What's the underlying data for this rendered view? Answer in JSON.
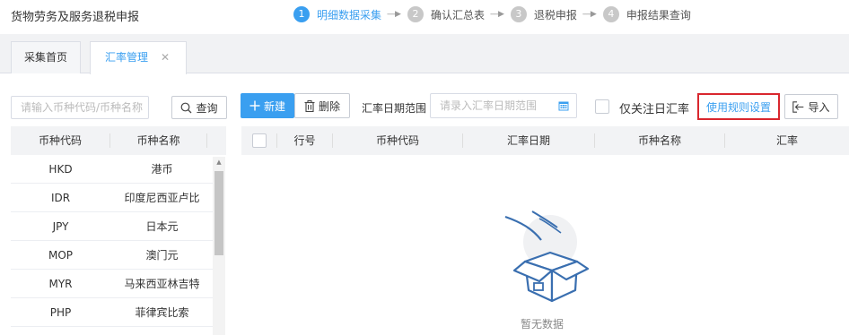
{
  "header": {
    "app_title": "货物劳务及服务退税申报",
    "steps": [
      {
        "num": "1",
        "label": "明细数据采集",
        "active": true
      },
      {
        "num": "2",
        "label": "确认汇总表",
        "active": false
      },
      {
        "num": "3",
        "label": "退税申报",
        "active": false
      },
      {
        "num": "4",
        "label": "申报结果查询",
        "active": false
      }
    ],
    "arrow": "----▶"
  },
  "tabs": {
    "home": "采集首页",
    "rate": "汇率管理",
    "close": "✕"
  },
  "left": {
    "search_placeholder": "请输入币种代码/币种名称",
    "query_label": "查询",
    "columns": [
      "币种代码",
      "币种名称"
    ],
    "rows": [
      {
        "code": "HKD",
        "name": "港币"
      },
      {
        "code": "IDR",
        "name": "印度尼西亚卢比"
      },
      {
        "code": "JPY",
        "name": "日本元"
      },
      {
        "code": "MOP",
        "name": "澳门元"
      },
      {
        "code": "MYR",
        "name": "马来西亚林吉特"
      },
      {
        "code": "PHP",
        "name": "菲律宾比索"
      }
    ]
  },
  "toolbar": {
    "new_label": "新建",
    "new_icon": "plus-icon",
    "delete_label": "删除",
    "delete_icon": "trash-icon",
    "date_range_label": "汇率日期范围",
    "date_placeholder": "请录入汇率日期范围",
    "focus_label": "仅关注日汇率",
    "rules_label": "使用规则设置",
    "import_label": "导入",
    "import_icon": "import-icon"
  },
  "table": {
    "columns": [
      "行号",
      "币种代码",
      "汇率日期",
      "币种名称",
      "汇率"
    ],
    "empty_text": "暂无数据"
  },
  "colors": {
    "accent": "#3a9ff0",
    "highlight_border": "#d9272e"
  }
}
